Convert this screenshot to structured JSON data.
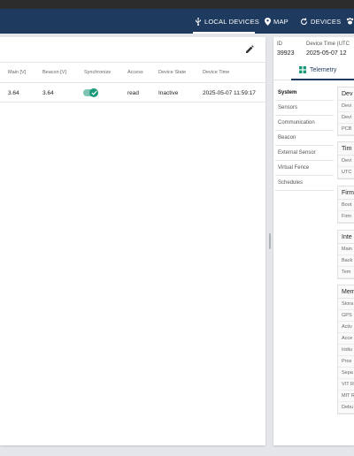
{
  "nav": {
    "local_devices": "LOCAL DEVICES",
    "map": "MAP",
    "devices": "DEVICES"
  },
  "table": {
    "columns": [
      "Main [V]",
      "Beacon [V]",
      "Synchronize",
      "Access",
      "Device State",
      "Device Time"
    ],
    "rows": [
      {
        "main_v": "3.64",
        "beacon_v": "3.64",
        "synchronize": true,
        "access": "read",
        "device_state": "Inactive",
        "device_time": "2025-05-07 11:59:17"
      }
    ]
  },
  "details": {
    "id_label": "ID",
    "id_value": "39923",
    "time_label": "Device Time (UTC",
    "time_value": "2025-05-07 12",
    "tab_label": "Telemetry",
    "nav_items": [
      "System",
      "Sensors",
      "Communication",
      "Beacon",
      "External Sensor",
      "Virtual Fence",
      "Schedules"
    ],
    "sections": [
      {
        "title": "Dev",
        "rows": [
          "Devi",
          "Devi",
          "PCB"
        ]
      },
      {
        "title": "Tim",
        "rows": [
          "Devi",
          "UTC"
        ]
      },
      {
        "title": "Firm",
        "rows": [
          "Boot",
          "Firm"
        ]
      },
      {
        "title": "Inte",
        "rows": [
          "Main",
          "Back",
          "Tem"
        ]
      },
      {
        "title": "Mem",
        "rows": [
          "Stora",
          "GPS",
          "Activ",
          "Acce",
          "Iridiu",
          "Prox",
          "Sepa",
          "VIT R",
          "MIT R",
          "Debu"
        ]
      }
    ]
  },
  "colors": {
    "appbar": "#1f3a5f",
    "accent": "#1a9a7a"
  }
}
